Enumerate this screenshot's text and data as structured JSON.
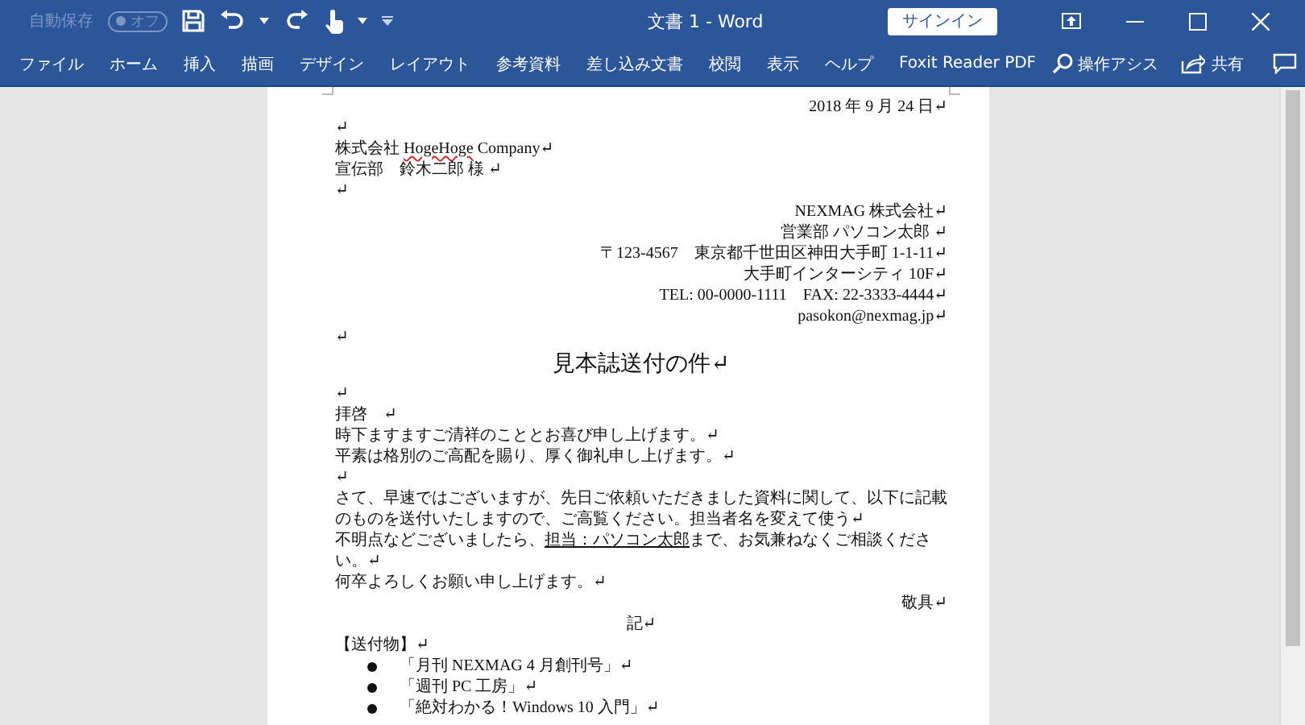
{
  "window": {
    "autosave_label": "自動保存",
    "autosave_toggle": {
      "label": "オフ",
      "on": false
    },
    "title": "文書 1 - Word",
    "signin_button": "サインイン"
  },
  "ribbon_tabs": [
    {
      "label": "ファイル",
      "selected": false
    },
    {
      "label": "ホーム",
      "selected": false
    },
    {
      "label": "挿入",
      "selected": false
    },
    {
      "label": "描画",
      "selected": false
    },
    {
      "label": "デザイン",
      "selected": false
    },
    {
      "label": "レイアウト",
      "selected": false
    },
    {
      "label": "参考資料",
      "selected": false
    },
    {
      "label": "差し込み文書",
      "selected": false
    },
    {
      "label": "校閲",
      "selected": false
    },
    {
      "label": "表示",
      "selected": false
    },
    {
      "label": "ヘルプ",
      "selected": false
    },
    {
      "label": "Foxit Reader PDF",
      "selected": false
    }
  ],
  "tell_me": "操作アシス",
  "share_button": "共有",
  "document": {
    "paragraphs": [
      {
        "kind": "right",
        "segments": [
          {
            "text": "2018 年 9 月 24 日↵"
          }
        ]
      },
      {
        "kind": "left",
        "segments": [
          {
            "text": "↵"
          }
        ]
      },
      {
        "kind": "left",
        "segments": [
          {
            "text": "株式会社 "
          },
          {
            "text": "HogeHoge",
            "misspelled": true
          },
          {
            "text": " Company↵"
          }
        ]
      },
      {
        "kind": "left",
        "segments": [
          {
            "text": "宣伝部　鈴木二郎 様 ↵"
          }
        ]
      },
      {
        "kind": "left",
        "segments": [
          {
            "text": "↵"
          }
        ]
      },
      {
        "kind": "right",
        "segments": [
          {
            "text": "NEXMAG 株式会社↵"
          }
        ]
      },
      {
        "kind": "right",
        "segments": [
          {
            "text": "営業部 パソコン太郎 ↵"
          }
        ]
      },
      {
        "kind": "right",
        "segments": [
          {
            "text": "〒123-4567　東京都千世田区神田大手町 1-1-11↵"
          }
        ]
      },
      {
        "kind": "right",
        "segments": [
          {
            "text": "大手町インターシティ 10F↵"
          }
        ]
      },
      {
        "kind": "right",
        "segments": [
          {
            "text": "TEL: 00-0000-1111　FAX: 22-3333-4444↵"
          }
        ]
      },
      {
        "kind": "right",
        "segments": [
          {
            "text": "pasokon@nexmag.jp↵"
          }
        ]
      },
      {
        "kind": "left",
        "segments": [
          {
            "text": "↵"
          }
        ]
      },
      {
        "kind": "title",
        "segments": [
          {
            "text": "見本誌送付の件↵"
          }
        ]
      },
      {
        "kind": "left",
        "segments": [
          {
            "text": "↵"
          }
        ]
      },
      {
        "kind": "left",
        "segments": [
          {
            "text": "拝啓　↵"
          }
        ]
      },
      {
        "kind": "left",
        "segments": [
          {
            "text": "時下ますますご清祥のこととお喜び申し上げます。↵"
          }
        ]
      },
      {
        "kind": "left",
        "segments": [
          {
            "text": "平素は格別のご高配を賜り、厚く御礼申し上げます。↵"
          }
        ]
      },
      {
        "kind": "left",
        "segments": [
          {
            "text": "↵"
          }
        ]
      },
      {
        "kind": "left",
        "segments": [
          {
            "text": "さて、早速ではございますが、先日ご依頼いただきました資料に関して、以下に記載のものを送付いたしますので、ご高覧ください。担当者名を変えて使う↵"
          }
        ]
      },
      {
        "kind": "left",
        "segments": [
          {
            "text": "不明点などございましたら、"
          },
          {
            "text": "担当：パソコン太郎",
            "underline": true
          },
          {
            "text": "まで、お気兼ねなくご相談ください。↵"
          }
        ]
      },
      {
        "kind": "left",
        "segments": [
          {
            "text": "何卒よろしくお願い申し上げます。↵"
          }
        ]
      },
      {
        "kind": "right",
        "segments": [
          {
            "text": "敬具↵"
          }
        ]
      },
      {
        "kind": "center",
        "segments": [
          {
            "text": "記↵"
          }
        ]
      },
      {
        "kind": "left",
        "segments": [
          {
            "text": "【送付物】↵"
          }
        ]
      },
      {
        "kind": "bullet",
        "segments": [
          {
            "text": "「月刊 NEXMAG 4 月創刊号」↵"
          }
        ]
      },
      {
        "kind": "bullet",
        "segments": [
          {
            "text": "「週刊 PC 工房」↵"
          }
        ]
      },
      {
        "kind": "bullet",
        "segments": [
          {
            "text": "「絶対わかる！Windows 10 入門」↵"
          }
        ]
      }
    ]
  }
}
